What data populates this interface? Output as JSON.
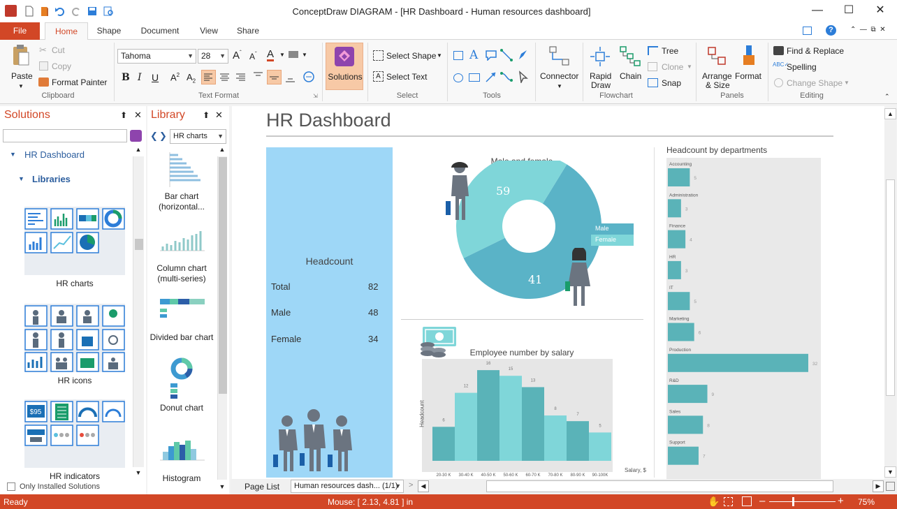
{
  "window": {
    "title": "ConceptDraw DIAGRAM - [HR Dashboard - Human resources dashboard]"
  },
  "tabs": [
    "File",
    "Home",
    "Shape",
    "Document",
    "View",
    "Share"
  ],
  "ribbon": {
    "clipboard": {
      "paste": "Paste",
      "cut": "Cut",
      "copy": "Copy",
      "format_painter": "Format Painter",
      "label": "Clipboard"
    },
    "text_format": {
      "font": "Tahoma",
      "size": "28",
      "label": "Text Format"
    },
    "solutions": {
      "label": "Solutions"
    },
    "select": {
      "select_shape": "Select Shape",
      "select_text": "Select Text",
      "label": "Select"
    },
    "tools": {
      "label": "Tools"
    },
    "connector": {
      "label": "Connector"
    },
    "flowchart": {
      "rapid_draw_1": "Rapid",
      "rapid_draw_2": "Draw",
      "chain": "Chain",
      "tree": "Tree",
      "clone": "Clone",
      "snap": "Snap",
      "label": "Flowchart"
    },
    "panels": {
      "arrange_1": "Arrange",
      "arrange_2": "& Size",
      "format": "Format",
      "label": "Panels"
    },
    "editing": {
      "find_replace": "Find & Replace",
      "spelling": "Spelling",
      "change_shape": "Change Shape",
      "label": "Editing"
    }
  },
  "solutions_panel": {
    "title": "Solutions",
    "tree_root": "HR Dashboard",
    "tree_child": "Libraries",
    "libraries": [
      "HR charts",
      "HR icons",
      "HR indicators"
    ],
    "only_installed": "Only Installed Solutions"
  },
  "library_panel": {
    "title": "Library",
    "selected": "HR charts",
    "items": [
      "Bar chart (horizontal...",
      "Column chart (multi-series)",
      "Divided bar chart",
      "Donut chart",
      "Histogram"
    ]
  },
  "dashboard": {
    "title": "HR Dashboard",
    "headcount": {
      "title": "Headcount",
      "rows": [
        {
          "label": "Total",
          "value": "82"
        },
        {
          "label": "Male",
          "value": "48"
        },
        {
          "label": "Female",
          "value": "34"
        }
      ]
    },
    "donut": {
      "title": "Male and female",
      "male_value": "59",
      "female_value": "41",
      "legend_male": "Male",
      "legend_female": "Female"
    },
    "salary": {
      "title": "Employee number by salary",
      "ylabel": "Headcount",
      "xlabel": "Salary, $"
    },
    "departments": {
      "title": "Headcount by departments"
    }
  },
  "chart_data": [
    {
      "type": "pie",
      "title": "Male and female",
      "categories": [
        "Male",
        "Female"
      ],
      "values": [
        59,
        41
      ],
      "colors": [
        "#5ab3c7",
        "#7fd6d9"
      ],
      "legend": "right"
    },
    {
      "type": "bar",
      "title": "Employee number by salary",
      "xlabel": "Salary, $",
      "ylabel": "Headcount",
      "categories": [
        "20-30 K",
        "30-40 K",
        "40-50 K",
        "50-60 K",
        "60-70 K",
        "70-80 K",
        "80-90 K",
        "90-100K"
      ],
      "values": [
        6,
        12,
        16,
        15,
        13,
        8,
        7,
        5
      ],
      "ylim": [
        0,
        17
      ],
      "colors": [
        "#5ab3b8",
        "#7fd6d9"
      ]
    },
    {
      "type": "bar",
      "orientation": "horizontal",
      "title": "Headcount by departments",
      "categories": [
        "Accounting",
        "Administration",
        "Finance",
        "HR",
        "IT",
        "Marketing",
        "Production",
        "R&D",
        "Sales",
        "Support"
      ],
      "values": [
        5,
        3,
        4,
        3,
        5,
        6,
        32,
        9,
        8,
        7
      ],
      "xlim": [
        0,
        35
      ],
      "color": "#5ab3b8"
    }
  ],
  "page_list": {
    "label": "Page List",
    "current": "Human resources dash... (1/1)"
  },
  "status": {
    "ready": "Ready",
    "mouse": "Mouse: [ 2.13, 4.81 ] in",
    "zoom": "75%"
  }
}
